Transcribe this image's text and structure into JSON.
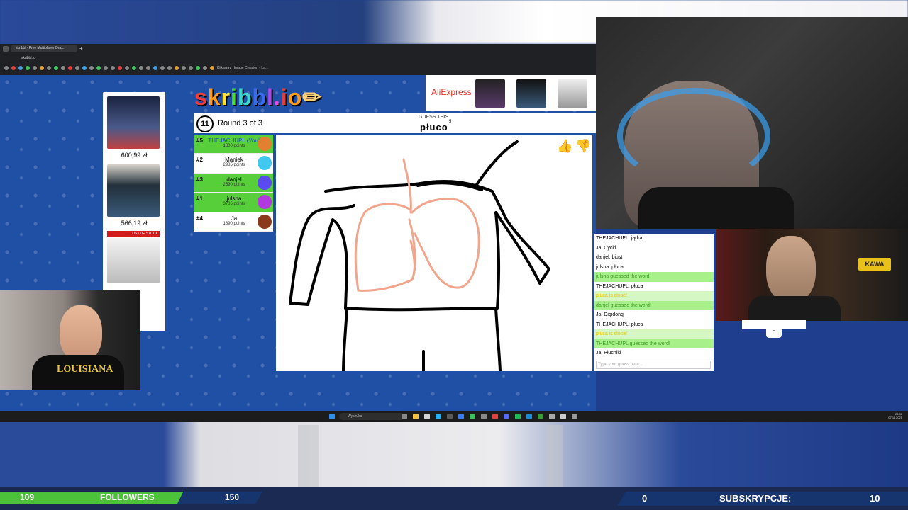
{
  "browser": {
    "tab_title": "skribbl - Free Multiplayer Dra...",
    "url": "skribbl.io",
    "bookmarks": [
      "Klikaway",
      "Image Creation - La..."
    ]
  },
  "game": {
    "logo": "skribbl.io",
    "round_timer": "11",
    "round_label": "Round 3 of 3",
    "guess_label": "GUESS THIS",
    "word": "płuco",
    "word_length": "5",
    "players": [
      {
        "rank": "#5",
        "name": "THEJACHUPL (You)",
        "points": "1800 points",
        "bg": "#56cf3a"
      },
      {
        "rank": "#2",
        "name": "Maniek",
        "points": "2985 points",
        "bg": "#ffffff"
      },
      {
        "rank": "#3",
        "name": "danjel",
        "points": "2590 points",
        "bg": "#56cf3a"
      },
      {
        "rank": "#1",
        "name": "julsha",
        "points": "3785 points",
        "bg": "#56cf3a"
      },
      {
        "rank": "#4",
        "name": "Ja",
        "points": "1890 points",
        "bg": "#ffffff"
      }
    ]
  },
  "chat": {
    "messages": [
      {
        "text": "THEJACHUPL: jądra",
        "style": "normal"
      },
      {
        "text": "Ja: Cycki",
        "style": "normal"
      },
      {
        "text": "danjel: biust",
        "style": "normal"
      },
      {
        "text": "julsha: płuca",
        "style": "normal"
      },
      {
        "text": "julsha guessed the word!",
        "style": "green"
      },
      {
        "text": "THEJACHUPL: płuca",
        "style": "normal"
      },
      {
        "text": "płuca is close!",
        "style": "close"
      },
      {
        "text": "danjel guessed the word!",
        "style": "green"
      },
      {
        "text": "Ja: Digidongi",
        "style": "normal"
      },
      {
        "text": "THEJACHUPL: płuca",
        "style": "normal"
      },
      {
        "text": "płuca is close!",
        "style": "close"
      },
      {
        "text": "THEJACHUPL guessed the word!",
        "style": "green"
      },
      {
        "text": "Ja: Płucniki",
        "style": "normal"
      }
    ],
    "input_placeholder": "Type your guess here..."
  },
  "ads": {
    "left_prices": [
      "600,99 zł",
      "566,19 zł"
    ],
    "left_stock_label": "US / UE STOCK",
    "top_brand": "AliExpress"
  },
  "taskbar": {
    "search_placeholder": "Wyszukaj",
    "time": "22:30",
    "date": "07.11.2025"
  },
  "stream": {
    "followers_current": "109",
    "followers_label": "FOLLOWERS",
    "followers_goal": "150",
    "subs_current": "0",
    "subs_label": "SUBSKRYPCJE:",
    "subs_goal": "10",
    "kawa_sign": "KAWA"
  },
  "colors": {
    "game_bg": "#2050a6",
    "guessed_green": "#56cf3a",
    "close_yellow": "#e6c200",
    "drawing_black": "#000000",
    "drawing_pink": "#f0a58c"
  }
}
